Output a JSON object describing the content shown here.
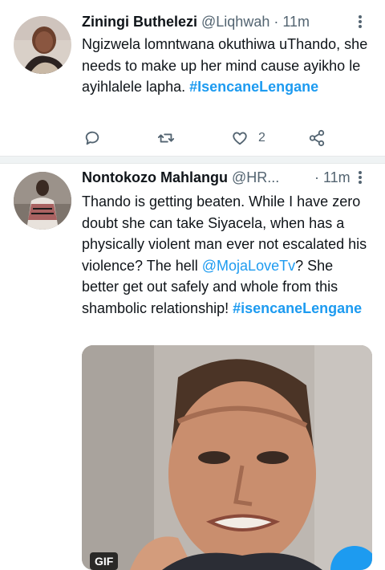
{
  "tweets": [
    {
      "name": "Ziningi Buthelezi",
      "handle": "@Liqhwah",
      "time": "· 11m",
      "text": "Ngizwela lomntwana okuthiwa uThando, she needs to make up her mind cause ayikho le ayihlalele lapha.",
      "hashtag": "#IsencaneLengane",
      "likes": "2",
      "icons": [
        "reply-icon",
        "retweet-icon",
        "like-icon",
        "share-icon"
      ]
    },
    {
      "name": "Nontokozo Mahlangu",
      "handle": "@HR...",
      "time": "· 11m",
      "text_part1": "Thando is getting beaten. While I have zero doubt she can take Siyacela, when has a physically violent man ever not escalated his violence? The hell ",
      "mention": "@MojaLoveTv",
      "text_part2": "? She better get out safely and whole from this shambolic relationship! ",
      "hashtag": "#isencaneLengane",
      "media_badge": "GIF"
    }
  ],
  "colors": {
    "accent": "#1d9bf0",
    "secondary_text": "#536471",
    "divider": "#eff3f4"
  }
}
